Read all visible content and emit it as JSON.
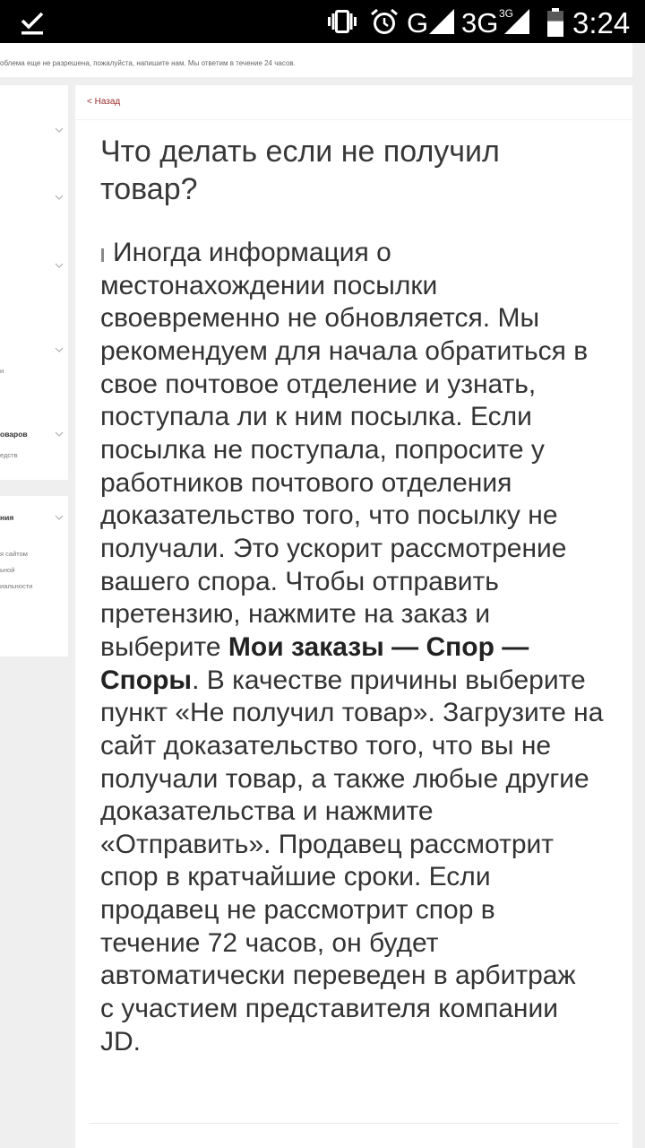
{
  "status_bar": {
    "time": "3:24",
    "network_primary": "G",
    "network_secondary": "3G",
    "network_secondary_badge": "3G",
    "battery_level": 0.6,
    "icons": {
      "notification": "download-done-icon",
      "vibrate": "vibrate-icon",
      "alarm": "alarm-icon",
      "signal_primary": "signal-icon",
      "signal_secondary": "signal-icon",
      "battery": "battery-icon"
    }
  },
  "notice": {
    "text": "облема еще не разрешена, пожалуйста, напишите нам. Мы ответим в течение 24 часов."
  },
  "sidebar": {
    "section_1": {
      "group_4_sub": "и",
      "group_5_title": "оваров",
      "group_5_sub": "едств"
    },
    "section_2": {
      "title": "ния",
      "links": [
        "я сайтом",
        "ьной",
        "иальности"
      ]
    },
    "icons": {
      "expand": "chevron-down-icon"
    }
  },
  "article": {
    "back_link": "< Назад",
    "title": "Что делать если не получил товар?",
    "body_lines": [
      [
        {
          "t": "Иногда информация о"
        }
      ],
      [
        {
          "t": "местонахождении посылки"
        }
      ],
      [
        {
          "t": "своевременно не обновляется. Мы"
        }
      ],
      [
        {
          "t": "рекомендуем для начала обратиться в"
        }
      ],
      [
        {
          "t": "свое почтовое отделение и узнать,"
        }
      ],
      [
        {
          "t": "поступала ли к ним посылка. Если"
        }
      ],
      [
        {
          "t": "посылка не поступала, попросите у"
        }
      ],
      [
        {
          "t": "работников почтового отделения"
        }
      ],
      [
        {
          "t": "доказательство того, что посылку не"
        }
      ],
      [
        {
          "t": "получали. Это ускорит рассмотрение"
        }
      ],
      [
        {
          "t": "вашего спора. Чтобы отправить"
        }
      ],
      [
        {
          "t": "претензию, нажмите на заказ и"
        }
      ],
      [
        {
          "t": "выберите "
        },
        {
          "t": "Мои заказы — Спор —",
          "strong": true
        }
      ],
      [
        {
          "t": "Споры",
          "strong": true
        },
        {
          "t": ". В качестве причины выберите"
        }
      ],
      [
        {
          "t": "пункт «Не получил товар». Загрузите на"
        }
      ],
      [
        {
          "t": "сайт доказательство того, что вы не"
        }
      ],
      [
        {
          "t": "получали товар, а также любые другие"
        }
      ],
      [
        {
          "t": "доказательства и нажмите"
        }
      ],
      [
        {
          "t": "«Отправить». Продавец рассмотрит"
        }
      ],
      [
        {
          "t": "спор в кратчайшие сроки. Если"
        }
      ],
      [
        {
          "t": "продавец не рассмотрит спор в"
        }
      ],
      [
        {
          "t": "течение 72 часов, он будет"
        }
      ],
      [
        {
          "t": "автоматически переведен в арбитраж"
        }
      ],
      [
        {
          "t": "с участием представителя компании"
        }
      ],
      [
        {
          "t": "JD."
        }
      ]
    ]
  },
  "colors": {
    "accent": "#9b2c2c",
    "text": "#333333",
    "page_background": "#efefef",
    "status_bar": "#000000"
  }
}
